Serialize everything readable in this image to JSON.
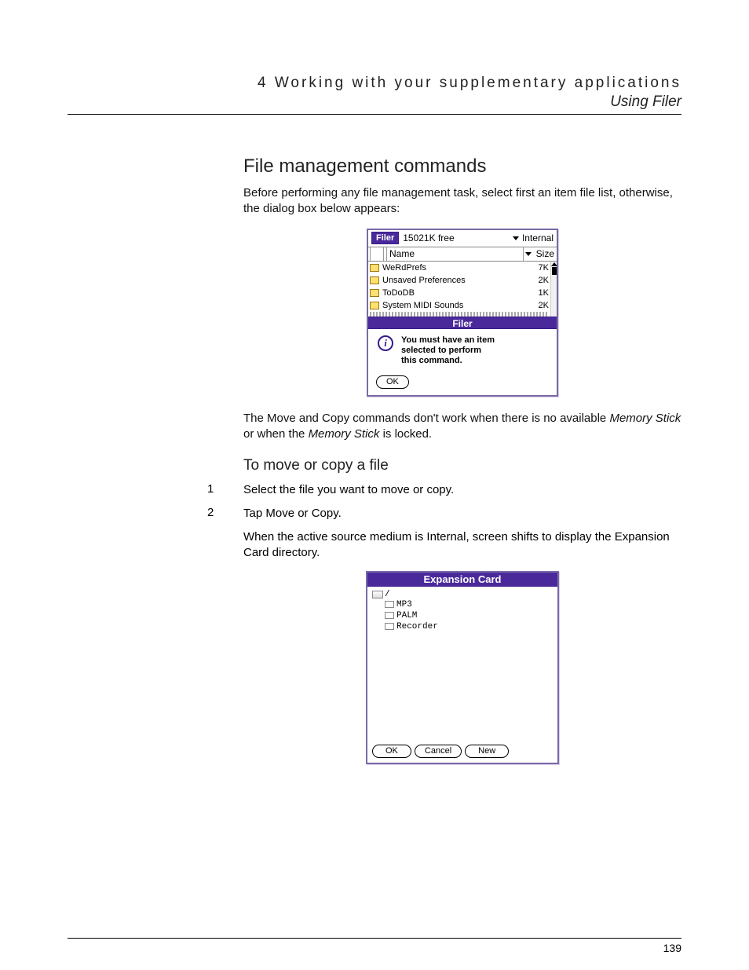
{
  "header": {
    "chapter": "4 Working with your supplementary applications",
    "section": "Using Filer"
  },
  "section1": {
    "heading": "File management commands",
    "intro": "Before performing any file management task, select first an item file list, otherwise, the dialog box below appears:",
    "after_fig_pre": "The Move and Copy commands don't work when there is no available ",
    "after_fig_em1": "Memory Stick",
    "after_fig_mid": " or when the ",
    "after_fig_em2": "Memory Stick",
    "after_fig_post": " is locked."
  },
  "filer_shot": {
    "app_label": "Filer",
    "free_space": "15021K free",
    "location": "Internal",
    "col_name": "Name",
    "col_size": "Size",
    "files": [
      {
        "name": "WeRdPrefs",
        "size": "7K"
      },
      {
        "name": "Unsaved Preferences",
        "size": "2K"
      },
      {
        "name": "ToDoDB",
        "size": "1K"
      },
      {
        "name": "System MIDI Sounds",
        "size": "2K"
      }
    ],
    "modal_title": "Filer",
    "modal_message_l1": "You must have an item",
    "modal_message_l2": "selected to perform",
    "modal_message_l3": "this command.",
    "ok_label": "OK"
  },
  "section2": {
    "heading": "To move or copy a file",
    "steps": [
      {
        "n": "1",
        "text": "Select the file you want to move or copy."
      },
      {
        "n": "2",
        "text": "Tap Move or Copy."
      }
    ],
    "note": "When the active source medium is Internal, screen shifts to display the Expansion Card directory."
  },
  "expansion_shot": {
    "title": "Expansion Card",
    "root": "/",
    "folders": [
      "MP3",
      "PALM",
      "Recorder"
    ],
    "buttons": {
      "ok": "OK",
      "cancel": "Cancel",
      "new": "New"
    }
  },
  "page_number": "139"
}
